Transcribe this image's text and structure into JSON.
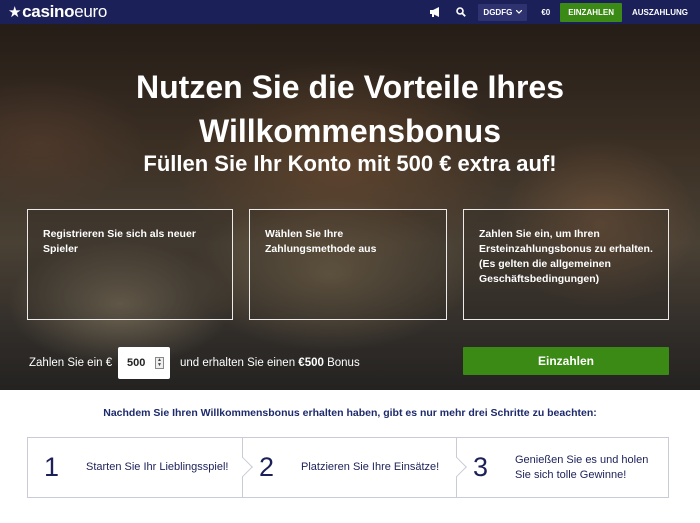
{
  "header": {
    "logo_bold": "casino",
    "logo_light": "euro",
    "language": "DGDFG",
    "balance": "€0",
    "deposit_label": "EINZAHLEN",
    "withdraw_label": "AUSZAHLUNG",
    "icons": [
      "megaphone-icon",
      "search-icon",
      "chevron-down-icon"
    ]
  },
  "hero": {
    "headline": "Nutzen Sie die Vorteile Ihres Willkommensbonus",
    "subheadline": "Füllen Sie Ihr Konto mit 500 € extra auf!",
    "steps": [
      "Registrieren Sie sich als neuer Spieler",
      "Wählen Sie Ihre Zahlungsmethode aus",
      "Zahlen Sie ein, um Ihren Ersteinzahlungsbonus zu erhalten. (Es gelten die allgemeinen Geschäftsbedingungen)"
    ],
    "promo_prefix": "Zahlen Sie ein €",
    "amount": "500",
    "promo_suffix_start": "und erhalten Sie einen ",
    "promo_bonus": "€500",
    "promo_suffix_end": " Bonus",
    "deposit_button": "Einzahlen"
  },
  "after": {
    "title": "Nachdem Sie Ihren Willkommensbonus erhalten haben, gibt es nur mehr drei Schritte zu beachten:",
    "steps": [
      {
        "num": "1",
        "text": "Starten Sie Ihr Lieblingsspiel!"
      },
      {
        "num": "2",
        "text": "Platzieren Sie Ihre Einsätze!"
      },
      {
        "num": "3",
        "text": "Genießen Sie es und holen Sie sich tolle Gewinne!"
      }
    ]
  },
  "colors": {
    "nav_bg": "#1c2059",
    "green": "#3b8a16",
    "text_dark": "#1c2059"
  }
}
